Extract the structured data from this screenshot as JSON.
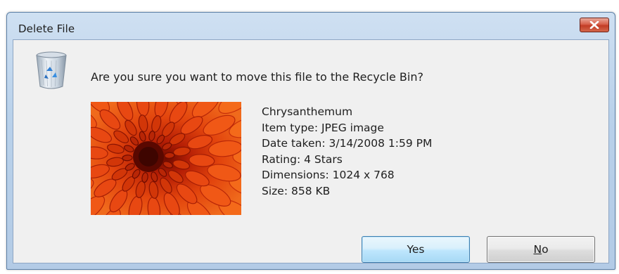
{
  "window": {
    "title": "Delete File",
    "close_icon": "close-icon"
  },
  "dialog": {
    "icon": "recycle-bin-icon",
    "question": "Are you sure you want to move this file to the Recycle Bin?",
    "thumbnail": "chrysanthemum-thumbnail",
    "details": {
      "name": "Chrysanthemum",
      "item_type": "Item type: JPEG image",
      "date_taken": "Date taken: 3/14/2008 1:59 PM",
      "rating": "Rating: 4 Stars",
      "dimensions": "Dimensions: 1024 x 768",
      "size": "Size: 858 KB"
    },
    "buttons": {
      "yes_label": "Yes",
      "no_mnemonic": "N",
      "no_rest": "o"
    }
  },
  "colors": {
    "title_bar": "#b9d1ea",
    "client_bg": "#f0f0f0",
    "close_button": "#c23c25",
    "default_button_border": "#3c7fb1"
  }
}
